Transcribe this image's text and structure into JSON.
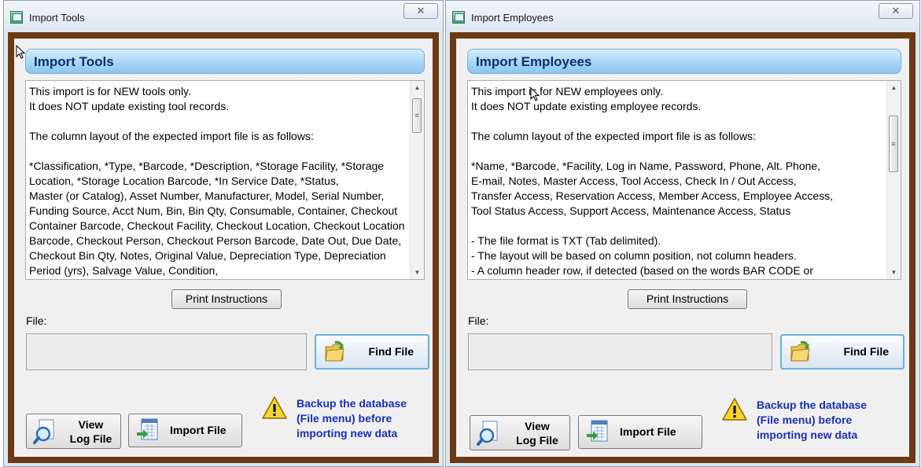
{
  "windows": [
    {
      "title": "Import Tools",
      "close_glyph": "✕",
      "header": "Import Tools",
      "instructions": "This import is for NEW tools only.\nIt does NOT update existing tool records.\n\nThe column layout of the expected import file is as follows:\n\n*Classification, *Type, *Barcode, *Description, *Storage Facility, *Storage Location, *Storage Location Barcode, *In Service Date, *Status,\nMaster (or Catalog), Asset Number, Manufacturer, Model, Serial Number, Funding Source, Acct Num, Bin, Bin Qty, Consumable, Container, Checkout Container Barcode, Checkout Facility, Checkout Location, Checkout Location Barcode, Checkout Person, Checkout Person Barcode, Date Out, Due Date, Checkout Bin Qty, Notes, Original Value, Depreciation Type, Depreciation Period (yrs), Salvage Value, Condition,",
      "print_button": "Print Instructions",
      "file_label": "File:",
      "file_value": "",
      "find_button": "Find File",
      "view_log_line1": "View",
      "view_log_line2": "Log File",
      "import_button": "Import File",
      "backup_line1": "Backup the database",
      "backup_line2": "(File menu) before",
      "backup_line3": "importing new data"
    },
    {
      "title": "Import Employees",
      "close_glyph": "✕",
      "header": "Import Employees",
      "instructions": "This import is for NEW employees only.\nIt does NOT update existing employee records.\n\nThe column layout of the expected import file is as follows:\n\n*Name, *Barcode, *Facility, Log in Name, Password, Phone, Alt. Phone,\nE-mail, Notes, Master Access, Tool Access, Check In / Out Access,\nTransfer Access, Reservation Access, Member Access, Employee Access,\nTool Status Access, Support Access, Maintenance Access, Status\n\n- The file format is TXT (Tab delimited).\n- The layout will be based on column position, not column headers.\n- A column header row, if detected (based on the words BAR CODE or",
      "print_button": "Print Instructions",
      "file_label": "File:",
      "file_value": "",
      "find_button": "Find File",
      "view_log_line1": "View",
      "view_log_line2": "Log File",
      "import_button": "Import File",
      "backup_line1": "Backup the database",
      "backup_line2": "(File menu) before",
      "backup_line3": "importing new data"
    }
  ],
  "colors": {
    "frame_border": "#6b3a12",
    "header_text": "#10306d",
    "backup_text": "#1a2fb8"
  },
  "icons": [
    "app-icon",
    "close-icon",
    "folder-icon",
    "magnifier-icon",
    "spreadsheet-icon",
    "warning-icon",
    "scroll-up-icon",
    "scroll-down-icon"
  ]
}
